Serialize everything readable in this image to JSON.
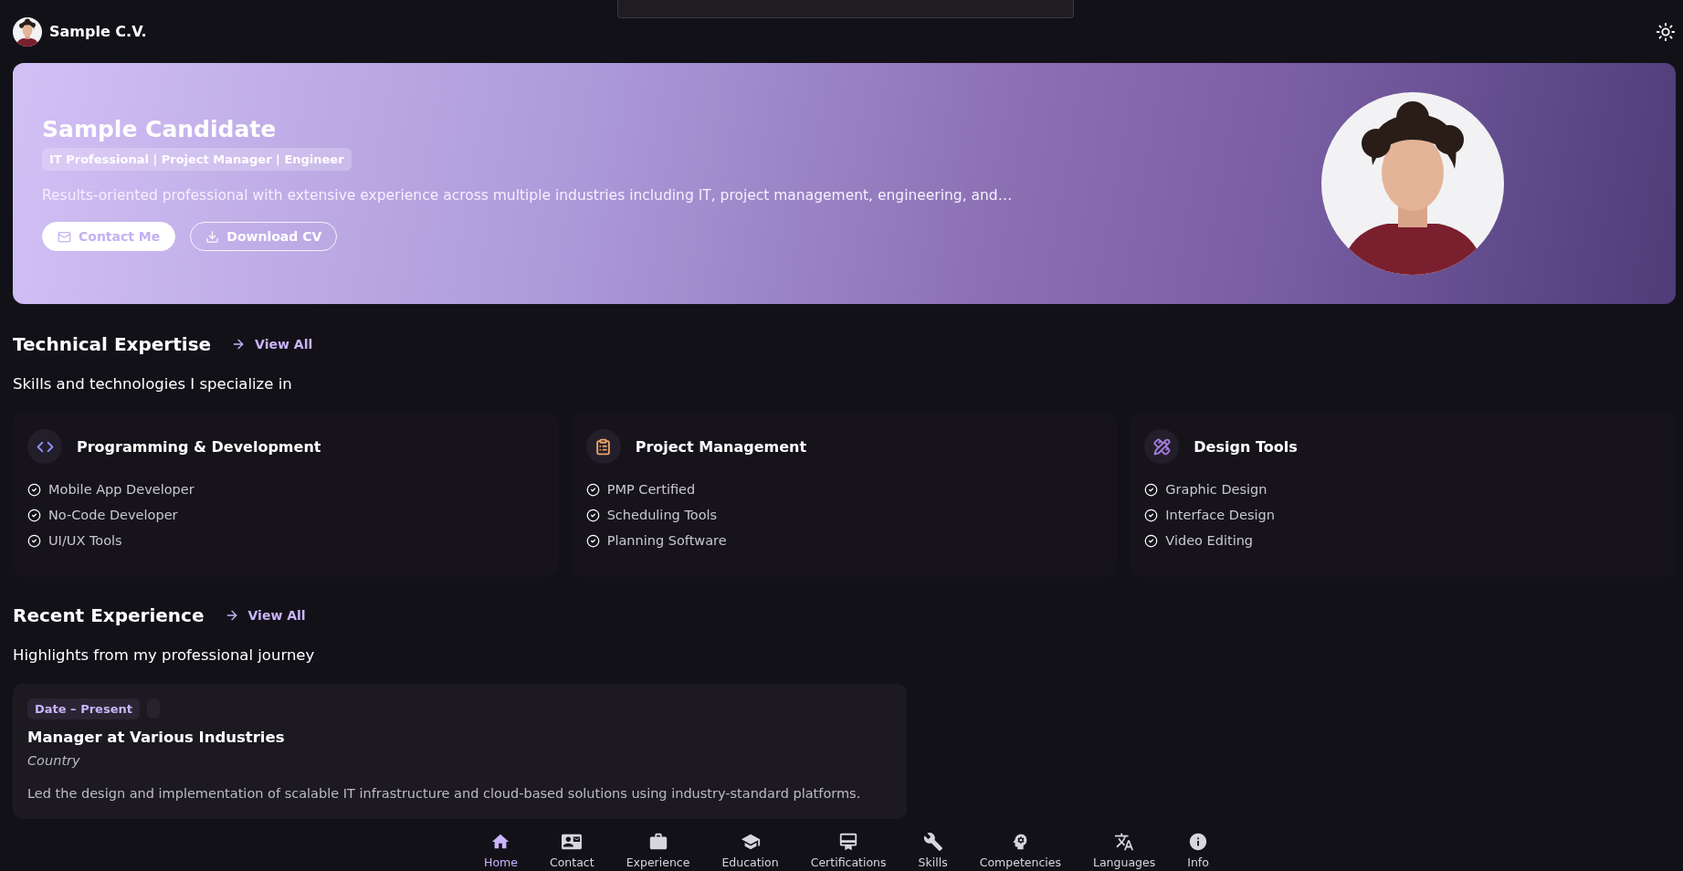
{
  "header": {
    "title": "Sample C.V."
  },
  "hero": {
    "name": "Sample Candidate",
    "tagline": "IT Professional | Project Manager | Engineer",
    "summary": "Results-oriented professional with extensive experience across multiple industries including IT, project management, engineering, and…",
    "buttons": [
      {
        "label": "Contact Me",
        "kind": "contact"
      },
      {
        "label": "Download CV",
        "kind": "download"
      }
    ]
  },
  "technical_expertise": {
    "title": "Technical Expertise",
    "link": "View All",
    "subtitle": "Skills and technologies I specialize in",
    "cards": [
      {
        "title": "Programming & Development",
        "kind": "code",
        "color": "#8a8ff0",
        "items": [
          "Mobile App Developer",
          "No-Code Developer",
          "UI/UX Tools"
        ]
      },
      {
        "title": "Project Management",
        "kind": "clipboard",
        "color": "#f0a468",
        "items": [
          "PMP Certified",
          "Scheduling Tools",
          "Planning Software"
        ]
      },
      {
        "title": "Design Tools",
        "kind": "design",
        "color": "#a77be0",
        "items": [
          "Graphic Design",
          "Interface Design",
          "Video Editing"
        ]
      }
    ]
  },
  "recent_experience": {
    "title": "Recent Experience",
    "link": "View All",
    "subtitle": "Highlights from my professional journey",
    "entries": [
      {
        "date": "Date – Present",
        "title": "Manager at Various Industries",
        "location": "Country",
        "description": "Led the design and implementation of scalable IT infrastructure and cloud-based solutions using industry-standard platforms."
      }
    ]
  },
  "bottom_nav": [
    {
      "label": "Home",
      "kind": "home",
      "selected": true
    },
    {
      "label": "Contact",
      "kind": "contact",
      "selected": false
    },
    {
      "label": "Experience",
      "kind": "experience",
      "selected": false
    },
    {
      "label": "Education",
      "kind": "education",
      "selected": false
    },
    {
      "label": "Certifications",
      "kind": "certifications",
      "selected": false
    },
    {
      "label": "Skills",
      "kind": "skills",
      "selected": false
    },
    {
      "label": "Competencies",
      "kind": "competencies",
      "selected": false
    },
    {
      "label": "Languages",
      "kind": "languages",
      "selected": false
    },
    {
      "label": "Info",
      "kind": "info",
      "selected": false
    }
  ]
}
